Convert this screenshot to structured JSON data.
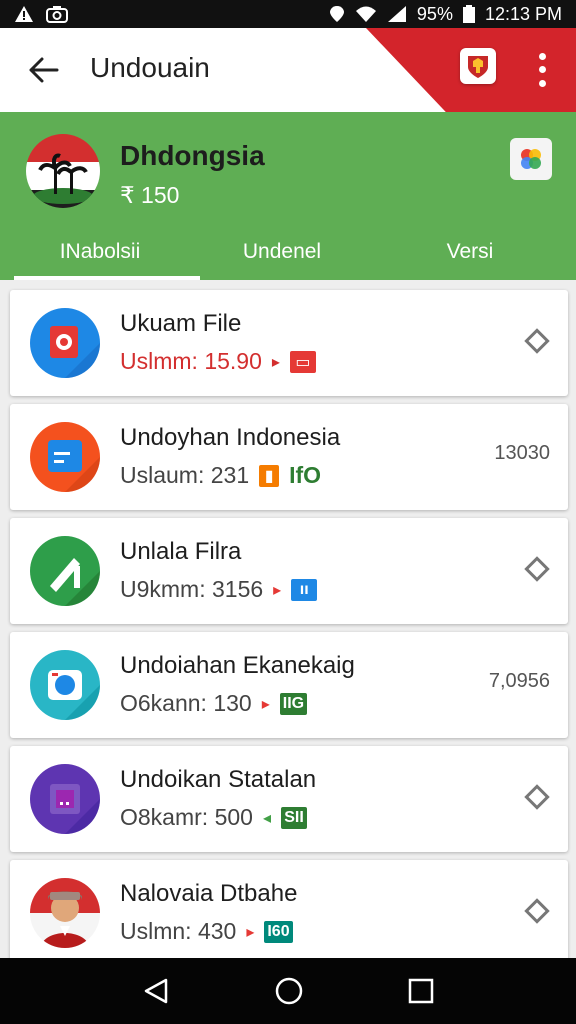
{
  "status_bar": {
    "left_icons": [
      "warning-icon",
      "camera-icon"
    ],
    "right_text": "95%",
    "clock": "12:13 PM"
  },
  "app_bar": {
    "title": "Undouain",
    "back_icon": "arrow-back-icon",
    "badge_icon": "crest-icon",
    "menu_icon": "more-vert-icon"
  },
  "header": {
    "title": "Dhdongsia",
    "subtitle": "₹ 150",
    "avatar_icon": "indonesia-flag-icon",
    "app_button_icon": "google-app-icon"
  },
  "tabs": [
    {
      "label": "INabolsii",
      "active": true
    },
    {
      "label": "Undenel",
      "active": false
    },
    {
      "label": "Versi",
      "active": false
    }
  ],
  "items": [
    {
      "name": "Ukuam File",
      "usage": "Uslmm: 15.90",
      "usage_color": "#d32f2f",
      "arrow": "▸",
      "arrow_color": "#d32f2f",
      "tag": "▭",
      "tag_color": "#e53935",
      "right_text": "",
      "right_icon": "diamond-icon",
      "icon": "file-icon",
      "icon_color": "#1e88e5"
    },
    {
      "name": "Undoyhan Indonesia",
      "usage": "Uslaum: 231",
      "usage_color": "#444444",
      "arrow": "",
      "arrow_color": "",
      "tag": "IfO",
      "tag_color": "#f57c00",
      "right_text": "13030",
      "right_icon": "",
      "icon": "calendar-icon",
      "icon_color": "#f4511e"
    },
    {
      "name": "Unlala Filra",
      "usage": "U9kmm: 3156",
      "usage_color": "#444444",
      "arrow": "▸",
      "arrow_color": "#e53935",
      "tag": "ıı",
      "tag_color": "#1e88e5",
      "right_text": "",
      "right_icon": "diamond-icon",
      "icon": "pencil-icon",
      "icon_color": "#2e9e4a"
    },
    {
      "name": "Undoiahan Ekanekaig",
      "usage": "O6kann: 130",
      "usage_color": "#444444",
      "arrow": "▸",
      "arrow_color": "#e53935",
      "tag": "IIG",
      "tag_color": "#2e7d32",
      "right_text": "7,0956",
      "right_icon": "",
      "icon": "camera-app-icon",
      "icon_color": "#29b6c6"
    },
    {
      "name": "Undoikan Statalan",
      "usage": "O8kamr: 500",
      "usage_color": "#444444",
      "arrow": "◂",
      "arrow_color": "#43a047",
      "tag": "SII",
      "tag_color": "#2e7d32",
      "right_text": "",
      "right_icon": "diamond-icon",
      "icon": "folder-icon",
      "icon_color": "#5e35b1"
    },
    {
      "name": "Nalovaia Dtbahe",
      "usage": "Uslmn: 430",
      "usage_color": "#444444",
      "arrow": "▸",
      "arrow_color": "#e53935",
      "tag": "I60",
      "tag_color": "#00897b",
      "right_text": "",
      "right_icon": "diamond-icon",
      "icon": "person-avatar-icon",
      "icon_color": "#d32f2f"
    }
  ],
  "nav_bar": {
    "back_icon": "nav-back-icon",
    "home_icon": "nav-home-icon",
    "recents_icon": "nav-recents-icon"
  },
  "colors": {
    "header_green": "#5fae54",
    "accent_red": "#d3242b"
  }
}
